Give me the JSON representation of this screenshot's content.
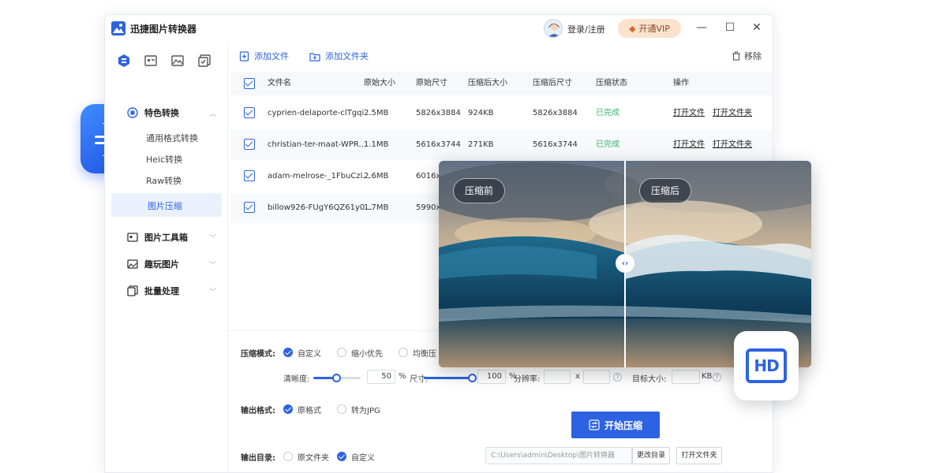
{
  "app": {
    "title": "迅捷图片转换器",
    "login": "登录/注册",
    "vip": "开通VIP"
  },
  "sidebar": {
    "groups": [
      {
        "label": "特色转换",
        "sub": [
          "通用格式转换",
          "Heic转换",
          "Raw转换",
          "图片压缩"
        ]
      },
      {
        "label": "图片工具箱"
      },
      {
        "label": "趣玩图片"
      },
      {
        "label": "批量处理"
      }
    ],
    "active": "图片压缩"
  },
  "toolbar": {
    "add_file": "添加文件",
    "add_folder": "添加文件夹",
    "remove": "移除"
  },
  "table": {
    "headers": [
      "文件名",
      "原始大小",
      "原始尺寸",
      "压缩后大小",
      "压缩后尺寸",
      "压缩状态",
      "操作"
    ],
    "rows": [
      {
        "name": "cyprien-delaporte-clTgqi...",
        "size": "2.5MB",
        "dim": "5826x3884",
        "new_size": "924KB",
        "new_dim": "5826x3884",
        "status": "已完成",
        "op1": "打开文件",
        "op2": "打开文件夹"
      },
      {
        "name": "christian-ter-maat-WPR...",
        "size": "1.1MB",
        "dim": "5616x3744",
        "new_size": "271KB",
        "new_dim": "5616x3744",
        "status": "已完成",
        "op1": "打开文件",
        "op2": "打开文件夹"
      },
      {
        "name": "adam-melrose-_1FbuCzl...",
        "size": "2.6MB",
        "dim": "6016x",
        "new_size": "",
        "new_dim": "",
        "status": "",
        "op1": "",
        "op2": ""
      },
      {
        "name": "billow926-FUgY6QZ61y0...",
        "size": "1.7MB",
        "dim": "5990x",
        "new_size": "",
        "new_dim": "",
        "status": "",
        "op1": "",
        "op2": ""
      }
    ]
  },
  "options": {
    "mode_label": "压缩模式:",
    "modes": [
      "自定义",
      "缩小优先",
      "均衡压"
    ],
    "clarity_label": "清晰度:",
    "clarity_value": "50",
    "clarity_fraction": 0.5,
    "percent": "%",
    "size_label": "尺寸:",
    "size_value": "100",
    "size_fraction": 1.0,
    "resolution_label": "分辨率:",
    "x_sep": "x",
    "target_label": "目标大小:",
    "kb": "KB",
    "help": "?",
    "format_label": "输出格式:",
    "formats": [
      "原格式",
      "转为JPG"
    ],
    "dir_label": "输出目录:",
    "dirs": [
      "原文件夹",
      "自定义"
    ],
    "path": "C:\\Users\\admin\\Desktop\\图片转换器",
    "change_dir": "更改目录",
    "open_folder": "打开文件夹",
    "start": "开始压缩"
  },
  "compare": {
    "before": "压缩前",
    "after": "压缩后",
    "handle": "‹›"
  },
  "hd_badge": "HD",
  "colors": {
    "accent": "#2d63e2",
    "done": "#3bb36e",
    "vip_bg": "#fbe2cf"
  }
}
